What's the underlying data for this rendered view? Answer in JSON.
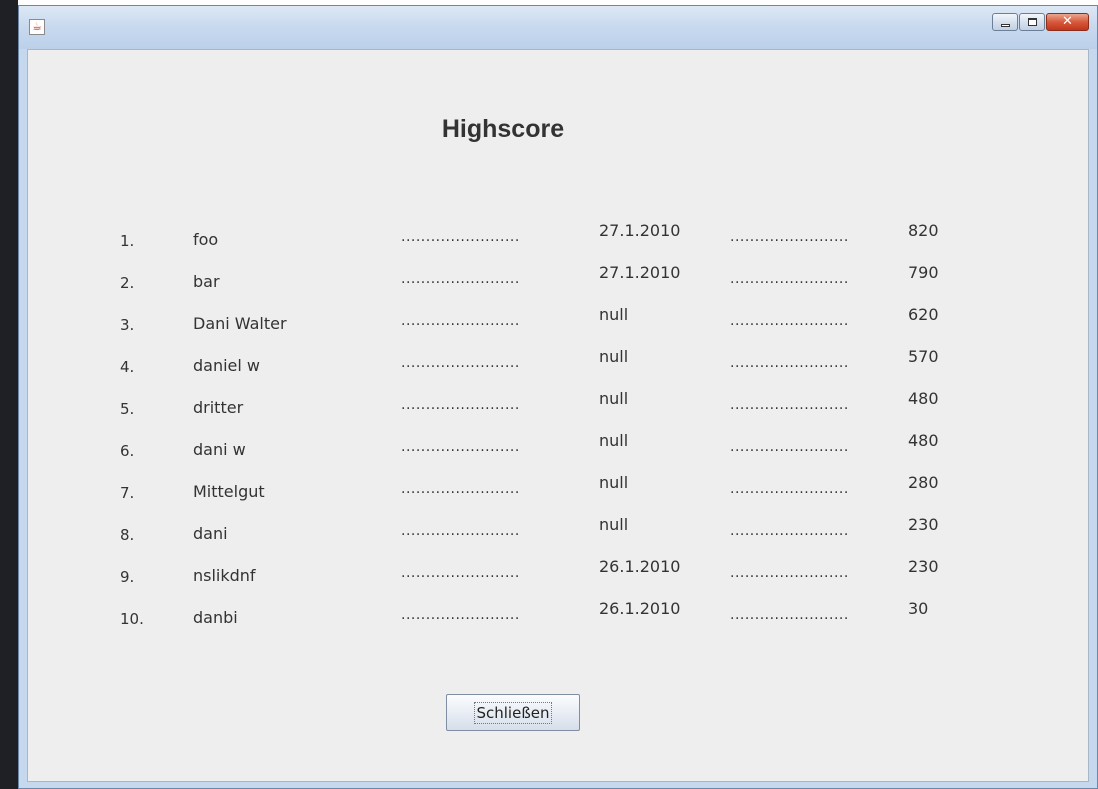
{
  "window": {
    "icon": "java-cup-icon",
    "controls": [
      "minimize-icon",
      "maximize-icon",
      "close-icon"
    ]
  },
  "heading": "Highscore",
  "dots": "........................",
  "entries": [
    {
      "rank": "1.",
      "name": "foo",
      "date": "27.1.2010",
      "score": "820"
    },
    {
      "rank": "2.",
      "name": "bar",
      "date": "27.1.2010",
      "score": "790"
    },
    {
      "rank": "3.",
      "name": "Dani Walter",
      "date": "null",
      "score": "620"
    },
    {
      "rank": "4.",
      "name": "daniel w",
      "date": "null",
      "score": "570"
    },
    {
      "rank": "5.",
      "name": "dritter",
      "date": "null",
      "score": "480"
    },
    {
      "rank": "6.",
      "name": "dani w",
      "date": "null",
      "score": "480"
    },
    {
      "rank": "7.",
      "name": "Mittelgut",
      "date": "null",
      "score": "280"
    },
    {
      "rank": "8.",
      "name": "dani",
      "date": "null",
      "score": "230"
    },
    {
      "rank": "9.",
      "name": "nslikdnf",
      "date": "26.1.2010",
      "score": "230"
    },
    {
      "rank": "10.",
      "name": "danbi",
      "date": "26.1.2010",
      "score": "30"
    }
  ],
  "close_button": "Schließen",
  "colors": {
    "titlebar": "#c9daef",
    "client_background": "#eeeeee",
    "close_control": "#c2361c",
    "text": "#333333"
  }
}
